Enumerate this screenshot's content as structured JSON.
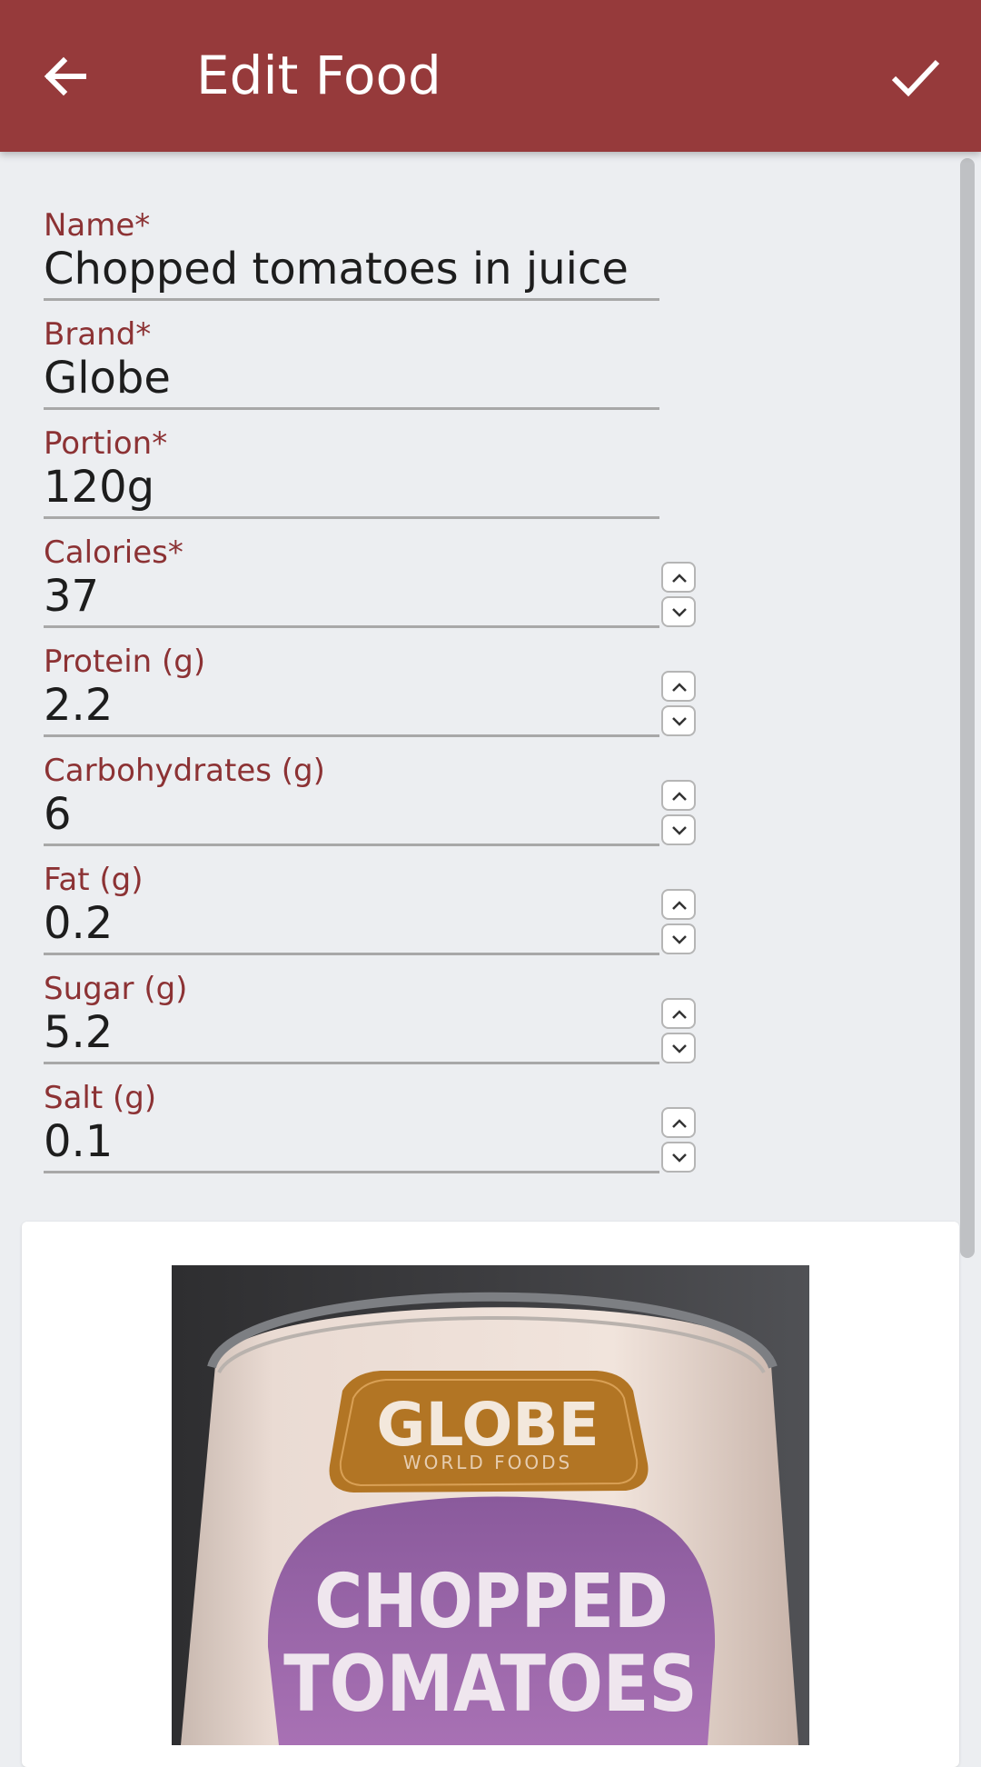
{
  "appbar": {
    "title": "Edit Food",
    "back_icon": "arrow-left-icon",
    "save_icon": "check-icon",
    "color": "#963a3b"
  },
  "form": {
    "fields": [
      {
        "label": "Name*",
        "value": "Chopped tomatoes in juice"
      },
      {
        "label": "Brand*",
        "value": "Globe"
      },
      {
        "label": "Portion*",
        "value": "120g"
      },
      {
        "label": "Calories*",
        "value": "37"
      },
      {
        "label": "Protein (g)",
        "value": "2.2"
      },
      {
        "label": "Carbohydrates (g)",
        "value": "6"
      },
      {
        "label": "Fat (g)",
        "value": "0.2"
      },
      {
        "label": "Sugar (g)",
        "value": "5.2"
      },
      {
        "label": "Salt (g)",
        "value": "0.1"
      }
    ]
  },
  "photo": {
    "brand_text": "GLOBE",
    "brand_sub": "WORLD FOODS",
    "product_line1": "CHOPPED",
    "product_line2": "TOMATOES"
  }
}
